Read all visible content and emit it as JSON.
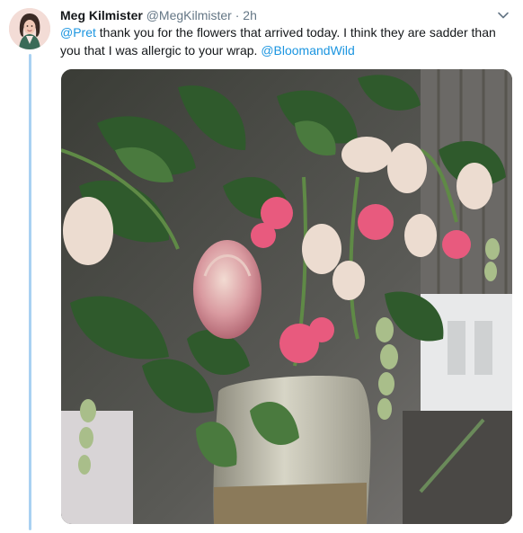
{
  "tweet": {
    "author_name": "Meg Kilmister",
    "handle": "@MegKilmister",
    "separator": "·",
    "time": "2h",
    "text_mention_1": "@Pret",
    "text_part_1": " thank you for the flowers that arrived today. I think they are sadder than you that I was allergic to your wrap. ",
    "text_mention_2": "@BloomandWild"
  },
  "icons": {
    "avatar": "avatar-photo",
    "menu": "chevron-down-icon",
    "media": "photo-of-wilted-flowers-in-vase"
  },
  "colors": {
    "link": "#1b95e0",
    "thread_line": "#a9d1f2",
    "secondary_text": "#657786"
  }
}
